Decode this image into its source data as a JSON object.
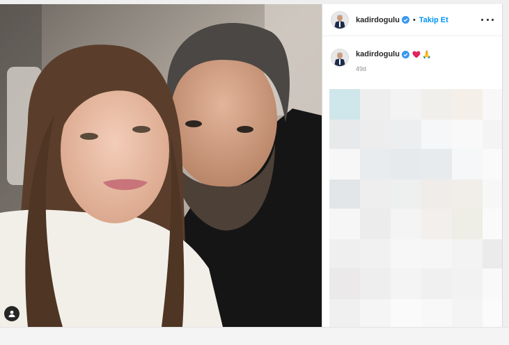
{
  "post": {
    "username": "kadirdogulu",
    "follow_label": "Takip Et",
    "separator": "•",
    "caption_emojis": "🙏",
    "timestamp": "49d"
  },
  "icons": {
    "verified": "verified-badge-icon",
    "heart": "red-heart-icon",
    "more": "more-options-icon",
    "user_tag": "user-tag-icon"
  },
  "colors": {
    "follow_blue": "#0095f6",
    "verified_blue": "#3897f0",
    "heart_red": "#e0245e",
    "text_dark": "#262626",
    "text_muted": "#8e8e8e"
  }
}
